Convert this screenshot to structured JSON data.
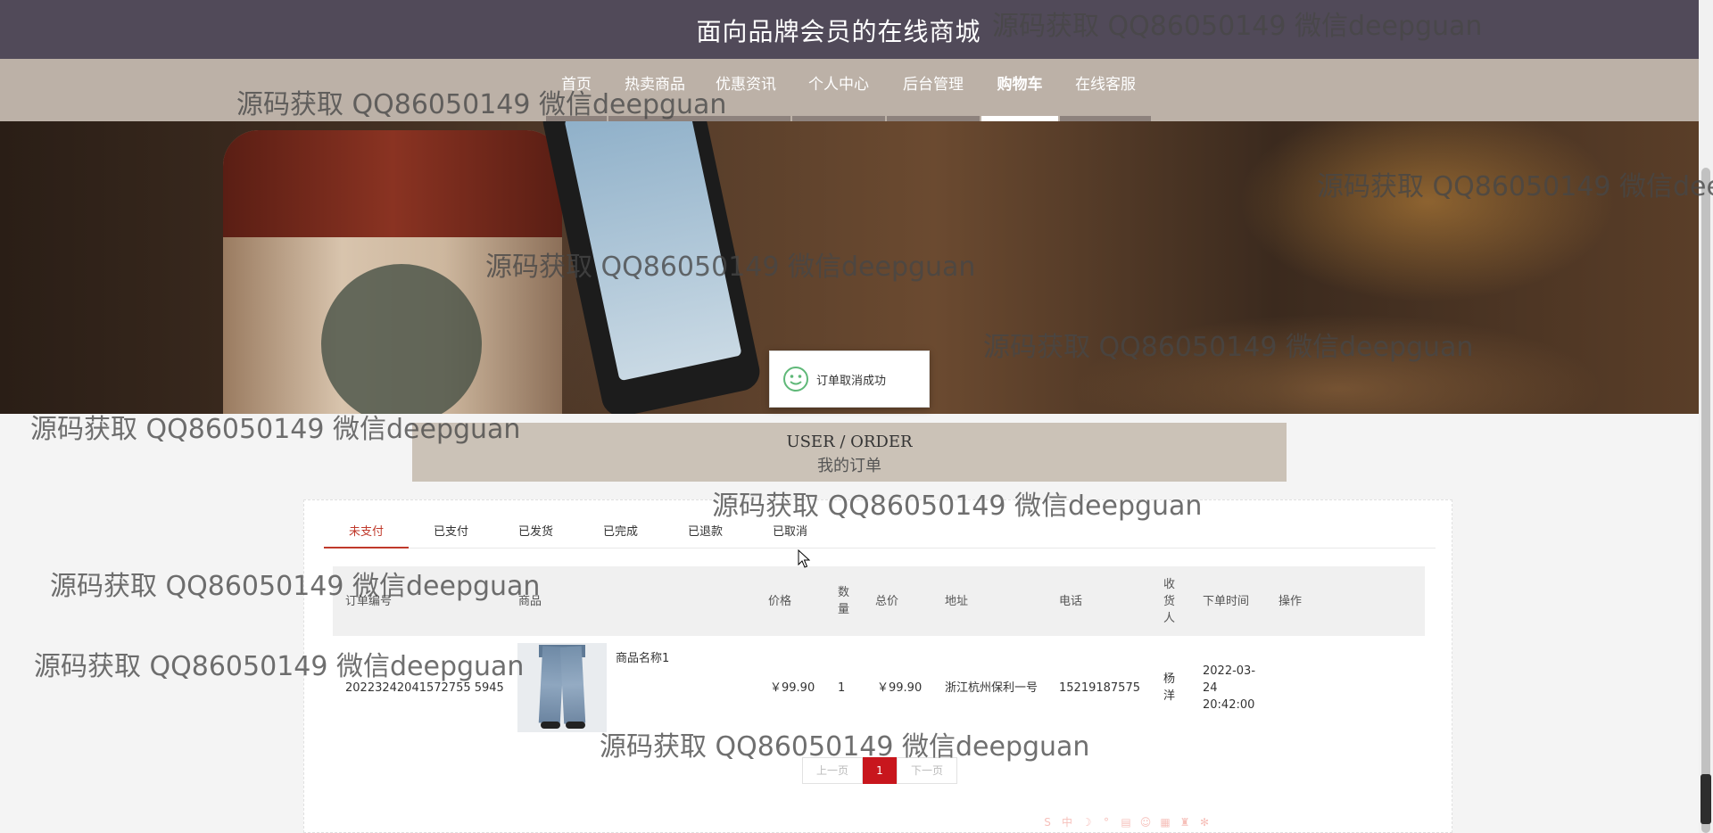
{
  "site": {
    "title": "面向品牌会员的在线商城"
  },
  "nav": {
    "items": [
      {
        "label": "首页"
      },
      {
        "label": "热卖商品"
      },
      {
        "label": "优惠资讯"
      },
      {
        "label": "个人中心"
      },
      {
        "label": "后台管理"
      },
      {
        "label": "购物车"
      },
      {
        "label": "在线客服"
      }
    ],
    "active_label": "购物车"
  },
  "toast": {
    "text": "订单取消成功",
    "icon": "smiley-icon"
  },
  "section": {
    "title_en": "USER / ORDER",
    "title_cn": "我的订单"
  },
  "tabs": {
    "items": [
      {
        "label": "未支付"
      },
      {
        "label": "已支付"
      },
      {
        "label": "已发货"
      },
      {
        "label": "已完成"
      },
      {
        "label": "已退款"
      },
      {
        "label": "已取消"
      }
    ],
    "active_label": "未支付"
  },
  "table": {
    "headers": {
      "order_no": "订单编号",
      "product": "商品",
      "price": "价格",
      "qty": "数量",
      "total": "总价",
      "address": "地址",
      "phone": "电话",
      "receiver": "收货人",
      "order_time": "下单时间",
      "action": "操作"
    },
    "rows": [
      {
        "order_no": "2022324204157275 55945",
        "order_no_full": "20223242041572755 5945",
        "product_name": "商品名称1",
        "price": "￥99.90",
        "qty": "1",
        "total": "￥99.90",
        "address": "浙江杭州保利一号",
        "phone": "15219187575",
        "receiver": "杨洋",
        "order_time": "2022-03-24 20:42:00"
      }
    ]
  },
  "pagination": {
    "prev": "上一页",
    "current": "1",
    "next": "下一页"
  },
  "watermark": {
    "text": "源码获取 QQ86050149 微信deepguan"
  },
  "colors": {
    "topbar": "#514a59",
    "navbar": "#bcb1a7",
    "accent_red": "#c8161d",
    "section_header": "#cbc2b7"
  }
}
